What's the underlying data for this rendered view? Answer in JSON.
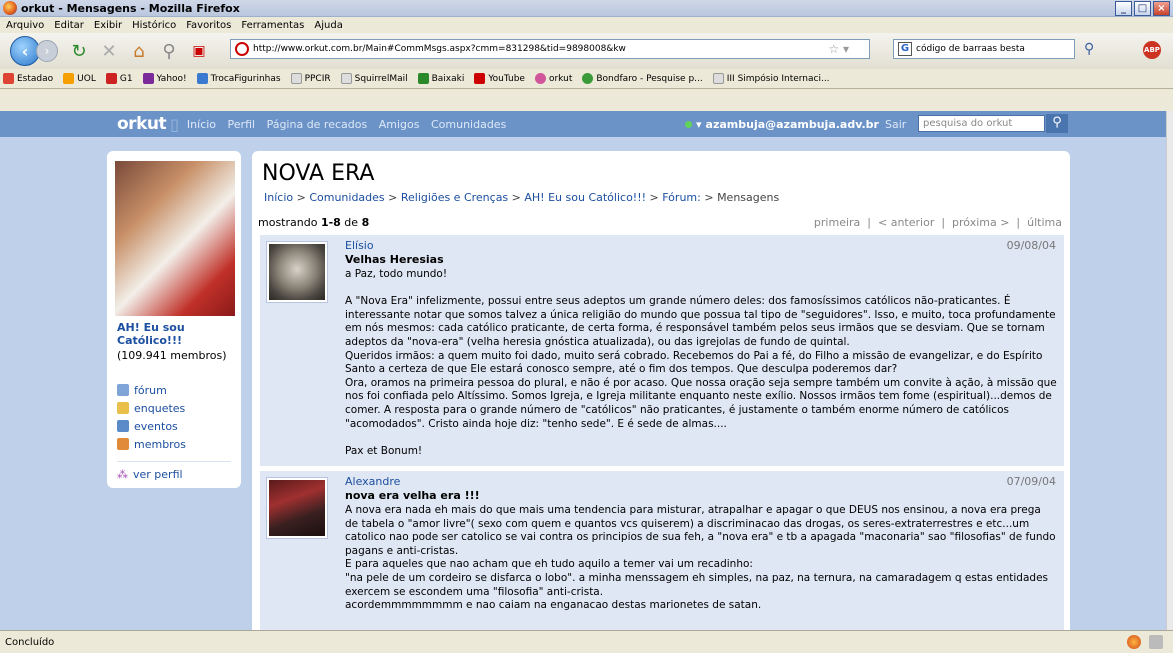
{
  "window": {
    "title": "orkut - Mensagens - Mozilla Firefox"
  },
  "menubar": [
    "Arquivo",
    "Editar",
    "Exibir",
    "Histórico",
    "Favoritos",
    "Ferramentas",
    "Ajuda"
  ],
  "navbar": {
    "url": "http://www.orkut.com.br/Main#CommMsgs.aspx?cmm=831298&tid=9898008&kw",
    "search_value": "código de barraas besta",
    "abp_label": "ABP"
  },
  "bookmarks": [
    {
      "label": "Estadao",
      "color": "#d43"
    },
    {
      "label": "UOL",
      "color": "#f5a000"
    },
    {
      "label": "G1",
      "color": "#c22"
    },
    {
      "label": "Yahoo!",
      "color": "#7b2a9a"
    },
    {
      "label": "TrocaFigurinhas",
      "color": "#3a7ad0"
    },
    {
      "label": "PPCIR",
      "color": "#ddd"
    },
    {
      "label": "SquirrelMail",
      "color": "#ddd"
    },
    {
      "label": "Baixaki",
      "color": "#2a8a2a"
    },
    {
      "label": "YouTube",
      "color": "#c00"
    },
    {
      "label": "orkut",
      "color": "#d0559a"
    },
    {
      "label": "Bondfaro - Pesquise p...",
      "color": "#3a9a3a"
    },
    {
      "label": "III Simpósio Internaci...",
      "color": "#ddd"
    }
  ],
  "orkut": {
    "logo": "orkut",
    "nav": [
      "Início",
      "Perfil",
      "Página de recados",
      "Amigos",
      "Comunidades"
    ],
    "user": "azambuja@azambuja.adv.br",
    "logout": "Sair",
    "search_placeholder": "pesquisa do orkut"
  },
  "community": {
    "name": "AH! Eu sou Católico!!!",
    "members": "(109.941 membros)",
    "menu": [
      {
        "label": "fórum",
        "color": "#7fa4d8"
      },
      {
        "label": "enquetes",
        "color": "#e9c14a"
      },
      {
        "label": "eventos",
        "color": "#5a8ac8"
      },
      {
        "label": "membros",
        "color": "#e08a3a"
      }
    ],
    "profile_link": "ver perfil"
  },
  "topic": {
    "title": "NOVA ERA",
    "breadcrumb": [
      "Início",
      "Comunidades",
      "Religiões e Crenças",
      "AH! Eu sou Católico!!!",
      "Fórum:"
    ],
    "breadcrumb_current": "Mensagens",
    "showing_prefix": "mostrando ",
    "showing_range": "1-8",
    "showing_of": " de ",
    "showing_total": "8",
    "pager": {
      "first": "primeira",
      "prev": "< anterior",
      "next": "próxima >",
      "last": "última"
    }
  },
  "posts": [
    {
      "author": "Elísio",
      "date": "09/08/04",
      "subject": "Velhas Heresias",
      "body": "a Paz, todo mundo!\n\nA \"Nova Era\" infelizmente, possui entre seus adeptos um grande número deles: dos famosíssimos católicos não-praticantes. É interessante notar que somos talvez a única religião do mundo que possua tal tipo de \"seguidores\". Isso, e muito, toca profundamente em nós mesmos: cada católico praticante, de certa forma, é responsável também pelos seus irmãos que se desviam. Que se tornam adeptos da \"nova-era\" (velha heresia gnóstica atualizada), ou das igrejolas de fundo de quintal.\nQueridos irmãos: a quem muito foi dado, muito será cobrado. Recebemos do Pai a fé, do Filho a missão de evangelizar, e do Espírito Santo a certeza de que Ele estará conosco sempre, até o fim dos tempos. Que desculpa poderemos dar?\nOra, oramos na primeira pessoa do plural, e não é por acaso. Que nossa oração seja sempre também um convite à ação, à missão que nos foi confiada pelo Altíssimo. Somos Igreja, e Igreja militante enquanto neste exílio. Nossos irmãos tem fome (espiritual)...demos de comer. A resposta para o grande número de \"católicos\" não praticantes, é justamente o também enorme número de católicos \"acomodados\". Cristo ainda hoje diz: \"tenho sede\". E é sede de almas....\n\nPax et Bonum!"
    },
    {
      "author": "Alexandre",
      "date": "07/09/04",
      "subject": "nova era velha era !!!",
      "body": "A nova era nada eh mais do que mais uma tendencia para misturar, atrapalhar e apagar o que DEUS nos ensinou, a nova era prega de tabela o \"amor livre\"( sexo com quem e quantos vcs quiserem) a discriminacao das drogas, os seres-extraterrestres e etc...um catolico nao pode ser catolico se vai contra os principios de sua feh, a \"nova era\" e tb a apagada \"maconaria\" sao \"filosofias\" de fundo pagans e anti-cristas.\nE para aqueles que nao acham que eh tudo aquilo a temer vai um recadinho:\n\"na pele de um cordeiro se disfarca o lobo\". a minha menssagem eh simples, na paz, na ternura, na camaradagem q estas entidades exercem se escondem uma \"filosofia\" anti-crista.\nacordemmmmmmmm e nao caiam na enganacao destas marionetes de satan."
    }
  ],
  "status": "Concluído"
}
